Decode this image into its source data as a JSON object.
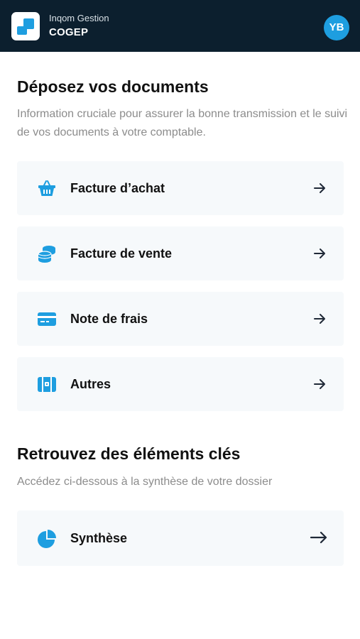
{
  "header": {
    "org_subtitle": "Inqom Gestion",
    "org_name": "COGEP",
    "avatar_initials": "YB"
  },
  "deposit": {
    "title": "Déposez vos documents",
    "description": "Information cruciale pour assurer la bonne transmission et le suivi de vos documents à votre comptable.",
    "items": [
      {
        "label": "Facture d’achat",
        "icon": "shopping-basket-icon"
      },
      {
        "label": "Facture de vente",
        "icon": "coin-stack-icon"
      },
      {
        "label": "Note de frais",
        "icon": "credit-card-icon"
      },
      {
        "label": "Autres",
        "icon": "briefcase-icon"
      }
    ]
  },
  "key_elements": {
    "title": "Retrouvez des éléments clés",
    "description": "Accédez ci-dessous à la synthèse de votre dossier",
    "items": [
      {
        "label": "Synthèse",
        "icon": "pie-chart-icon"
      }
    ]
  },
  "colors": {
    "header_bg": "#0c1f2e",
    "accent": "#1e9ee0",
    "card_bg": "#f6f9fb",
    "text": "#111111",
    "muted_text": "#8c8c8c"
  }
}
